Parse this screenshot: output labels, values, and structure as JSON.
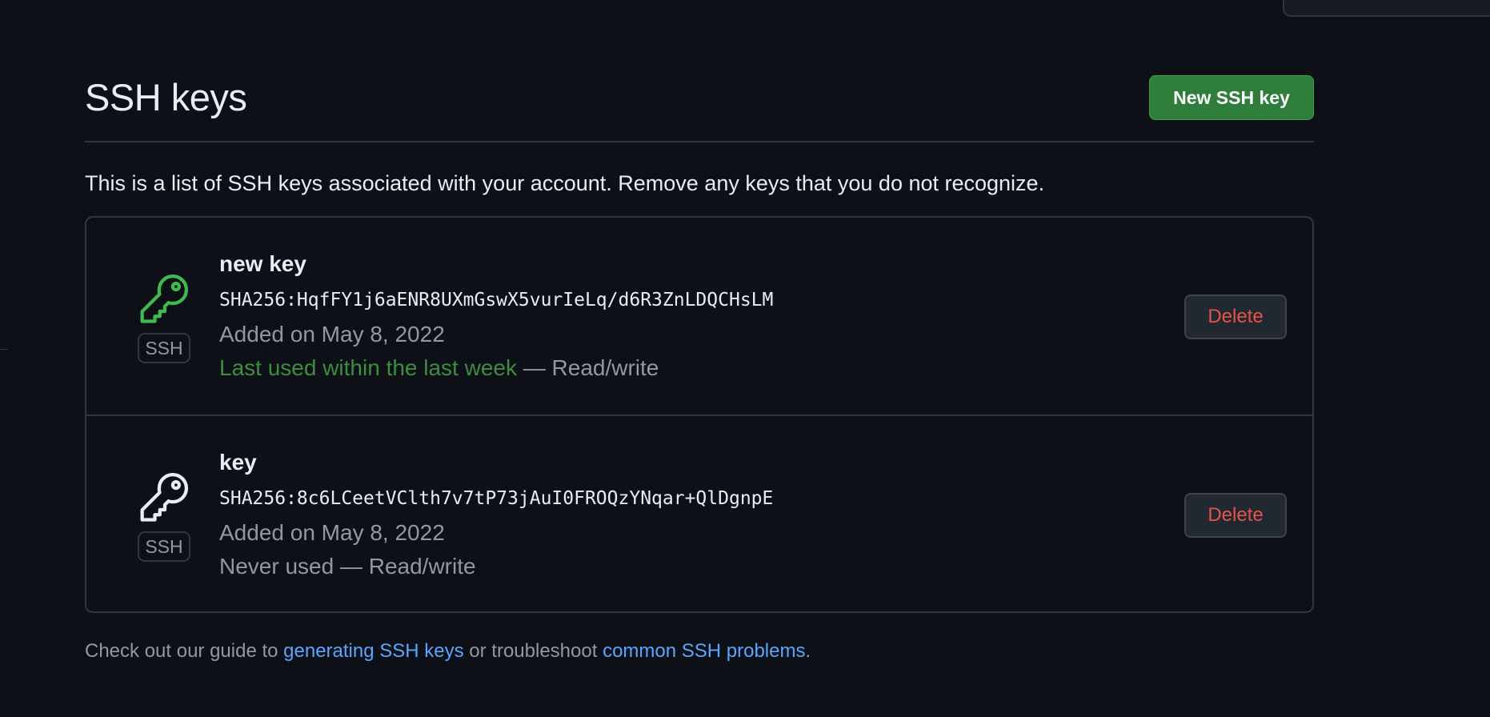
{
  "header": {
    "title": "SSH keys",
    "new_key_label": "New SSH key"
  },
  "description": "This is a list of SSH keys associated with your account. Remove any keys that you do not recognize.",
  "keys": [
    {
      "title": "new key",
      "badge": "SSH",
      "fingerprint": "SHA256:HqfFY1j6aENR8UXmGswX5vurIeLq/d6R3ZnLDQCHsLM",
      "added": "Added on May 8, 2022",
      "last_used": "Last used within the last week",
      "access": " — Read/write",
      "icon": "key-icon",
      "icon_color": "#3fb950",
      "delete_label": "Delete"
    },
    {
      "title": "key",
      "badge": "SSH",
      "fingerprint": "SHA256:8c6LCeetVClth7v7tP73jAuI0FROQzYNqar+QlDgnpE",
      "added": "Added on May 8, 2022",
      "last_used": "Never used",
      "access": " — Read/write",
      "icon": "key-icon",
      "icon_color": "#e6edf3",
      "delete_label": "Delete"
    }
  ],
  "footer": {
    "prefix": "Check out our guide to ",
    "link1": "generating SSH keys",
    "middle": " or troubleshoot ",
    "link2": "common SSH problems",
    "suffix": "."
  },
  "colors": {
    "background": "#0d1117",
    "border": "#30363d",
    "primary_button": "#238636",
    "danger_text": "#f85149",
    "link": "#58a6ff",
    "success_text": "#3fb950"
  }
}
